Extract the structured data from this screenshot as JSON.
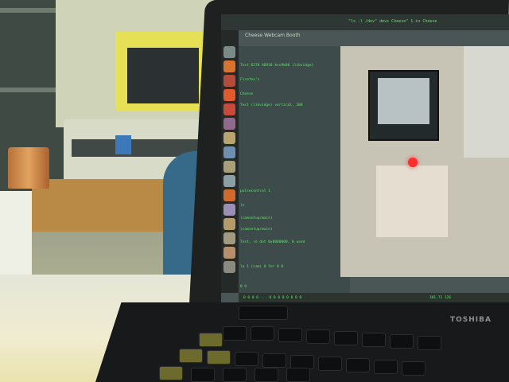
{
  "scene": {
    "description_tag": "photo",
    "accent_colors": {
      "terminal_green": "#5fe36a",
      "poster_yellow": "#e6e055",
      "shirt_blue": "#366a88",
      "copper": "#c47f41",
      "led_red": "#ff2e2e"
    }
  },
  "laptop": {
    "brand": "TOSHIBA",
    "window_title": "Cheese Webcam Booth",
    "header_text": "\"ls -l /dev\" devs Cheese\" 1-in Cheese",
    "terminal_lines": [
      "Test 6570 ADVS8 kvv9k00 (libvidge)",
      "Firefox's",
      "Cheese",
      "Test (libvidge) vertical, 388",
      "",
      "",
      "",
      "",
      "",
      "pulsecontrol 1",
      "",
      "lv",
      "(camsetup/main)",
      "(camsetup/main)",
      "Test, re dot 0x0000000, 0 used",
      "",
      "",
      "la 1 (cam) 0 for 0 0",
      "",
      "0 0"
    ],
    "status_left": "0 0 0 0 ... 0 0 0 0 0 0 0 0",
    "status_right": "301.71 126"
  },
  "launcher_icons": [
    "home-icon",
    "firefox-icon",
    "files-icon",
    "ubuntu-one-icon",
    "app-icon",
    "app-icon",
    "app-icon",
    "app-icon",
    "app-icon",
    "app-icon",
    "app-icon",
    "app-icon",
    "app-icon",
    "app-icon",
    "app-icon",
    "app-icon"
  ]
}
